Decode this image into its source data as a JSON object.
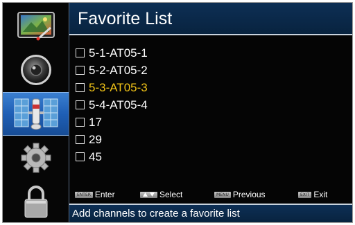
{
  "header": {
    "title": "Favorite List"
  },
  "sidebar": {
    "items": [
      {
        "icon": "picture-icon",
        "active": false
      },
      {
        "icon": "speaker-icon",
        "active": false
      },
      {
        "icon": "satellite-icon",
        "active": true
      },
      {
        "icon": "gear-icon",
        "active": false
      },
      {
        "icon": "lock-icon",
        "active": false
      }
    ]
  },
  "channels": [
    {
      "label": "5-1-AT05-1",
      "checked": false,
      "selected": false
    },
    {
      "label": "5-2-AT05-2",
      "checked": false,
      "selected": false
    },
    {
      "label": "5-3-AT05-3",
      "checked": false,
      "selected": true
    },
    {
      "label": "5-4-AT05-4",
      "checked": false,
      "selected": false
    },
    {
      "label": "17",
      "checked": false,
      "selected": false
    },
    {
      "label": "29",
      "checked": false,
      "selected": false
    },
    {
      "label": "45",
      "checked": false,
      "selected": false
    }
  ],
  "help": {
    "enter": {
      "key": "ENTER",
      "label": "Enter"
    },
    "select": {
      "label": "Select"
    },
    "previous": {
      "key": "MENU",
      "label": "Previous"
    },
    "exit": {
      "key": "EXIT",
      "label": "Exit"
    }
  },
  "status": {
    "text": "Add channels to create a favorite list"
  },
  "colors": {
    "selected_text": "#f2c417",
    "header_bg": "#0b2a4d",
    "active_tab": "#2a6ec4"
  }
}
